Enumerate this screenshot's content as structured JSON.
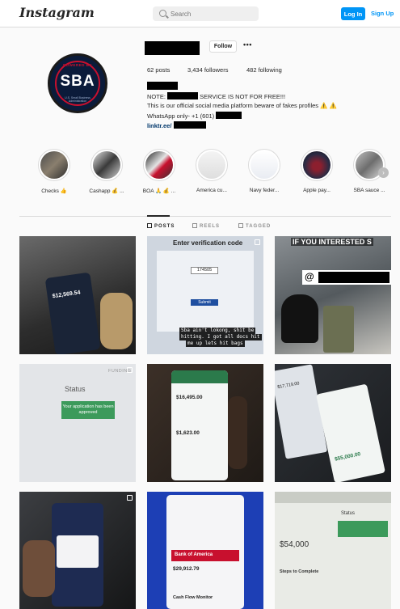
{
  "topbar": {
    "logo": "Instagram",
    "search_placeholder": "Search",
    "login_label": "Log In",
    "signup_label": "Sign Up"
  },
  "profile": {
    "avatar_top": "POWERED BY",
    "avatar_text": "SBA",
    "avatar_bottom": "U.S. Small Business Administration",
    "follow_label": "Follow",
    "more": "•••",
    "posts": "62 posts",
    "followers": "3,434 followers",
    "following": "482 following",
    "bio": {
      "line1_prefix": "NOTE:",
      "line1_suffix": "SERVICE IS NOT FOR FREE!!!",
      "line2": "This is our official social media platform beware of fakes profiles ⚠️ ⚠️",
      "line3": "WhatsApp only- +1 (601)",
      "link": "linktr.ee/"
    }
  },
  "highlights": [
    {
      "label": "Checks 👍"
    },
    {
      "label": "Cashapp 💰 ..."
    },
    {
      "label": "BOA 🙏 💰 ..."
    },
    {
      "label": "America cu..."
    },
    {
      "label": "Navy feder..."
    },
    {
      "label": "Apple pay..."
    },
    {
      "label": "SBA sauce ..."
    }
  ],
  "tabs": {
    "posts": "POSTS",
    "reels": "REELS",
    "tagged": "TAGGED"
  },
  "posts": {
    "p1_balance": "$12,569.54",
    "p2_title": "Enter verification code",
    "p2_code": "174505",
    "p2_submit": "Submit",
    "p2_caption": [
      "Sba ain't lokong, shit be",
      "hitting. I got all docs hit",
      "me up lets hit bags"
    ],
    "p3_caption": "IF YOU INTERESTED S",
    "p3_handle": "@",
    "p4_status": "Status",
    "p4_approved": "Your application has been approved",
    "p4_funding": "FUNDING",
    "p5_amount1": "$16,495.00",
    "p5_amount2": "$1,623.00",
    "p6_amount1": "$17,719.00",
    "p6_amount2": "$55,000.00",
    "p8_bank": "Bank of America",
    "p8_amount": "$29,912.79",
    "p8_sub": "Cash Flow Monitor",
    "p9_status": "Status",
    "p9_amount": "$54,000",
    "p9_steps": "Steps to Complete"
  }
}
